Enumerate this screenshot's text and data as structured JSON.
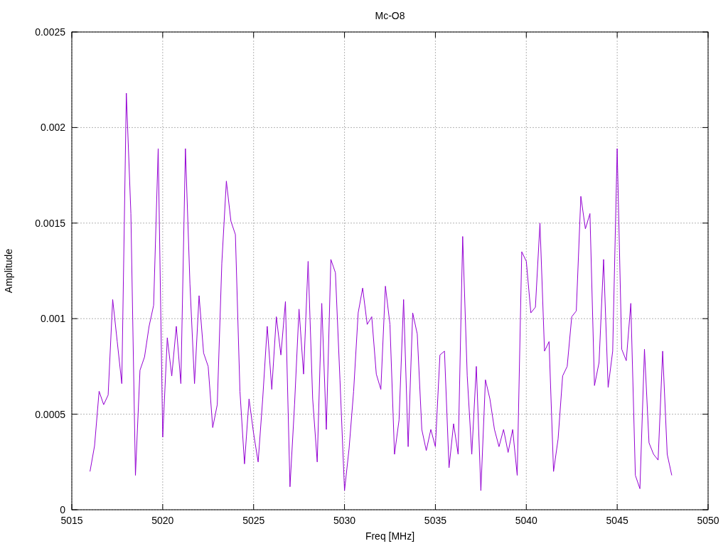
{
  "chart_data": {
    "type": "line",
    "grid": true,
    "title": "Mc-O8",
    "xlabel": "Freq [MHz]",
    "ylabel": "Amplitude",
    "xlim": [
      5015,
      5050
    ],
    "ylim": [
      0,
      0.0025
    ],
    "xticks": [
      5015,
      5020,
      5025,
      5030,
      5035,
      5040,
      5045,
      5050
    ],
    "yticks": [
      0,
      0.0005,
      0.001,
      0.0015,
      0.002,
      0.0025
    ],
    "x": [
      5016,
      5016.25,
      5016.5,
      5016.75,
      5017,
      5017.25,
      5017.5,
      5017.75,
      5018,
      5018.25,
      5018.5,
      5018.75,
      5019,
      5019.25,
      5019.5,
      5019.75,
      5020,
      5020.25,
      5020.5,
      5020.75,
      5021,
      5021.25,
      5021.5,
      5021.75,
      5022,
      5022.25,
      5022.5,
      5022.75,
      5023,
      5023.25,
      5023.5,
      5023.75,
      5024,
      5024.25,
      5024.5,
      5024.75,
      5025,
      5025.25,
      5025.5,
      5025.75,
      5026,
      5026.25,
      5026.5,
      5026.75,
      5027,
      5027.25,
      5027.5,
      5027.75,
      5028,
      5028.25,
      5028.5,
      5028.75,
      5029,
      5029.25,
      5029.5,
      5029.75,
      5030,
      5030.25,
      5030.5,
      5030.75,
      5031,
      5031.25,
      5031.5,
      5031.75,
      5032,
      5032.25,
      5032.5,
      5032.75,
      5033,
      5033.25,
      5033.5,
      5033.75,
      5034,
      5034.25,
      5034.5,
      5034.75,
      5035,
      5035.25,
      5035.5,
      5035.75,
      5036,
      5036.25,
      5036.5,
      5036.75,
      5037,
      5037.25,
      5037.5,
      5037.75,
      5038,
      5038.25,
      5038.5,
      5038.75,
      5039,
      5039.25,
      5039.5,
      5039.75,
      5040,
      5040.25,
      5040.5,
      5040.75,
      5041,
      5041.25,
      5041.5,
      5041.75,
      5042,
      5042.25,
      5042.5,
      5042.75,
      5043,
      5043.25,
      5043.5,
      5043.75,
      5044,
      5044.25,
      5044.5,
      5044.75,
      5045,
      5045.25,
      5045.5,
      5045.75,
      5046,
      5046.25,
      5046.5,
      5046.75,
      5047,
      5047.25,
      5047.5,
      5047.75,
      5048
    ],
    "series": [
      {
        "color": "#9400d3",
        "values": [
          0.0002,
          0.000335,
          0.00062,
          0.00055,
          0.0006,
          0.0011,
          0.00088,
          0.00066,
          0.00218,
          0.00155,
          0.00018,
          0.00073,
          0.0008,
          0.00096,
          0.00107,
          0.00189,
          0.00038,
          0.0009,
          0.0007,
          0.00096,
          0.00066,
          0.00189,
          0.00118,
          0.00066,
          0.00112,
          0.00082,
          0.00075,
          0.00043,
          0.00055,
          0.00129,
          0.00172,
          0.00151,
          0.00144,
          0.00062,
          0.00024,
          0.00058,
          0.0004,
          0.00025,
          0.00058,
          0.00096,
          0.00063,
          0.00101,
          0.00081,
          0.00109,
          0.00012,
          0.00055,
          0.00105,
          0.00071,
          0.0013,
          0.00058,
          0.00025,
          0.00108,
          0.00042,
          0.00131,
          0.00124,
          0.00068,
          0.0001,
          0.00032,
          0.00062,
          0.00103,
          0.00116,
          0.00097,
          0.00101,
          0.00071,
          0.00063,
          0.00117,
          0.00097,
          0.00029,
          0.00047,
          0.0011,
          0.00033,
          0.00103,
          0.00092,
          0.00042,
          0.00031,
          0.00042,
          0.00033,
          0.00081,
          0.00083,
          0.00022,
          0.00045,
          0.00029,
          0.00143,
          0.0007,
          0.00029,
          0.00075,
          0.0001,
          0.00068,
          0.00058,
          0.00042,
          0.00033,
          0.00042,
          0.0003,
          0.00042,
          0.00018,
          0.00135,
          0.0013,
          0.00103,
          0.00106,
          0.0015,
          0.00083,
          0.00088,
          0.0002,
          0.00037,
          0.0007,
          0.00075,
          0.00101,
          0.00104,
          0.00164,
          0.00147,
          0.00155,
          0.00065,
          0.00077,
          0.00131,
          0.00064,
          0.00083,
          0.00189,
          0.00084,
          0.00078,
          0.00108,
          0.00018,
          0.00011,
          0.00084,
          0.00035,
          0.00029,
          0.00026,
          0.00083,
          0.00029,
          0.00018
        ]
      }
    ]
  }
}
